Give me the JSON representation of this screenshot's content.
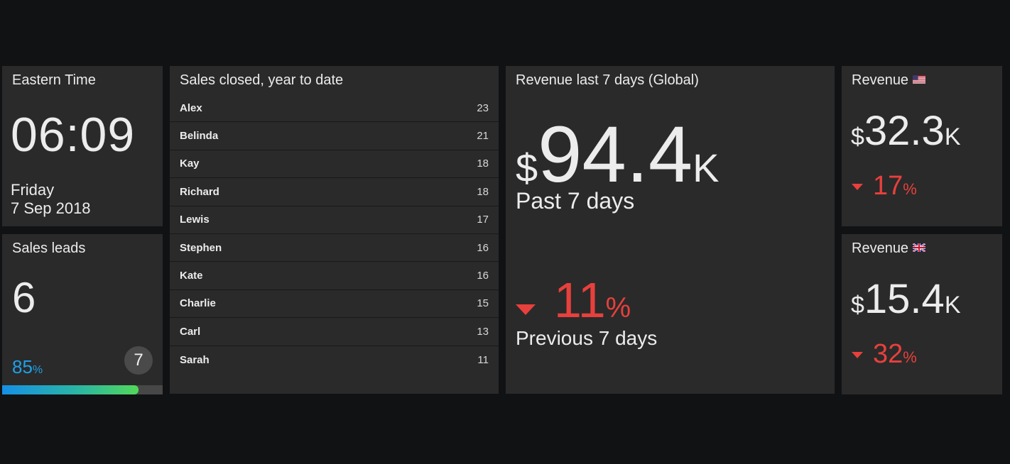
{
  "colors": {
    "background": "#111214",
    "tile": "#2a2a2a",
    "negative": "#e8403c",
    "progress": "#1fa0e8",
    "progress_gradient_end": "#52d85a"
  },
  "clock": {
    "title": "Eastern Time",
    "time": "06:09",
    "day": "Friday",
    "date": "7 Sep 2018"
  },
  "sales_leads": {
    "title": "Sales leads",
    "value": "6",
    "progress_value": "85",
    "progress_unit": "%",
    "progress_fraction": 0.85,
    "goal": "7"
  },
  "sales_closed": {
    "title": "Sales closed, year to date",
    "rows": [
      {
        "name": "Alex",
        "value": "23"
      },
      {
        "name": "Belinda",
        "value": "21"
      },
      {
        "name": "Kay",
        "value": "18"
      },
      {
        "name": "Richard",
        "value": "18"
      },
      {
        "name": "Lewis",
        "value": "17"
      },
      {
        "name": "Stephen",
        "value": "16"
      },
      {
        "name": "Kate",
        "value": "16"
      },
      {
        "name": "Charlie",
        "value": "15"
      },
      {
        "name": "Carl",
        "value": "13"
      },
      {
        "name": "Sarah",
        "value": "11"
      }
    ]
  },
  "revenue_global": {
    "title": "Revenue last 7 days (Global)",
    "currency": "$",
    "value": "94.4",
    "unit": "K",
    "caption": "Past 7 days",
    "change_value": "11",
    "change_unit": "%",
    "change_direction": "down",
    "change_caption": "Previous 7 days"
  },
  "revenue_us": {
    "title": "Revenue",
    "flag_icon": "us-flag-icon",
    "currency": "$",
    "value": "32.3",
    "unit": "K",
    "change_value": "17",
    "change_unit": "%",
    "change_direction": "down"
  },
  "revenue_uk": {
    "title": "Revenue",
    "flag_icon": "uk-flag-icon",
    "currency": "$",
    "value": "15.4",
    "unit": "K",
    "change_value": "32",
    "change_unit": "%",
    "change_direction": "down"
  }
}
